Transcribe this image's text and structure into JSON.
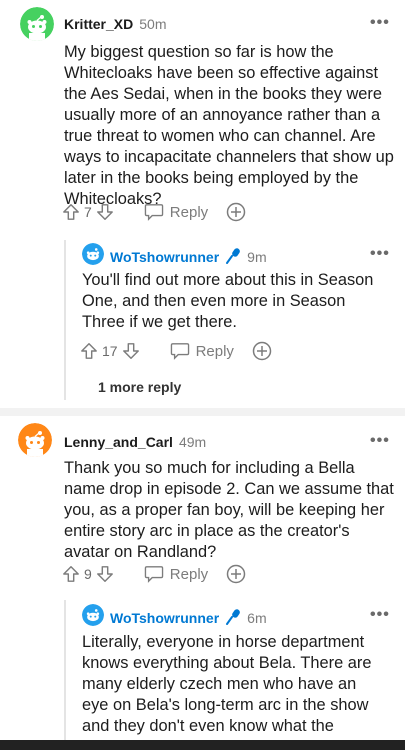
{
  "comments": [
    {
      "username": "Kritter_XD",
      "time": "50m",
      "text": "My biggest question so far is how the Whitecloaks have been so effective against the Aes Sedai, when in the books they were usually more of an annoyance rather than a true threat to women who can channel. Are ways to incapacitate channelers that show up later in the books being employed by the Whitecloaks?",
      "votes": "7",
      "reply_label": "Reply"
    },
    {
      "username": "WoTshowrunner",
      "time": "9m",
      "text": "You'll find out more about this in Season One, and then even more in Season Three if we get there.",
      "votes": "17",
      "reply_label": "Reply",
      "more_replies": "1 more reply"
    },
    {
      "username": "Lenny_and_Carl",
      "time": "49m",
      "text": "Thank you so much for including a Bella name drop in episode 2. Can we assume that you, as a proper fan boy, will be keeping her entire story arc in place as the creator's avatar on Randland?",
      "votes": "9",
      "reply_label": "Reply"
    },
    {
      "username": "WoTshowrunner",
      "time": "6m",
      "text": "Literally, everyone in horse department knows everything about Bela. There are many elderly czech men who have an eye on Bela's long-term arc in the show and they don't even know what the Wheel of Time is."
    }
  ],
  "more_menu_glyph": "•••",
  "colors": {
    "accent": "#0079d3",
    "avatar_green": "#46d160",
    "avatar_orange": "#ff8717",
    "avatar_teal": "#24a0ed"
  },
  "icons": [
    "upvote-icon",
    "downvote-icon",
    "reply-icon",
    "award-icon",
    "microphone-icon",
    "more-options-icon"
  ]
}
